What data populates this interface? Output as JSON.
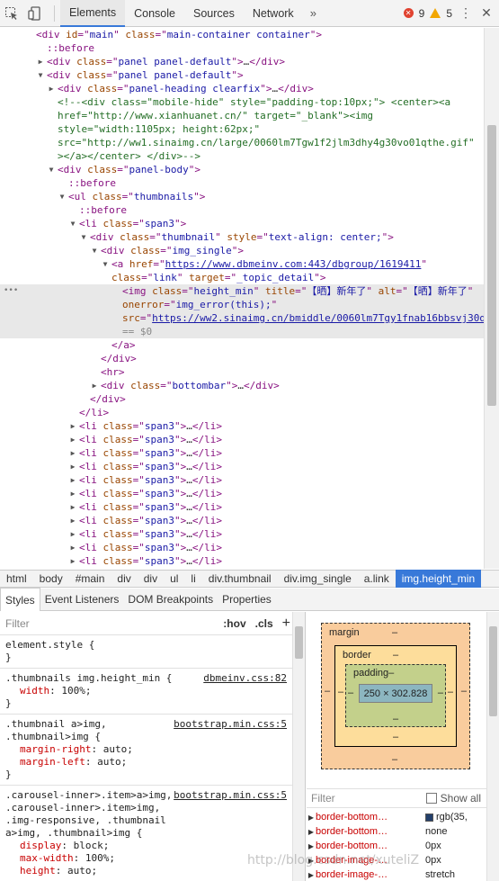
{
  "toolbar": {
    "tabs": [
      "Elements",
      "Console",
      "Sources",
      "Network"
    ],
    "more": "»",
    "error_count": "9",
    "warning_count": "5"
  },
  "dom": {
    "lines": [
      {
        "indent": 40,
        "parts": [
          [
            "tag",
            "<div "
          ],
          [
            "attr",
            "id"
          ],
          [
            "punct",
            "=\""
          ],
          [
            "val",
            "main"
          ],
          [
            "punct",
            "\" "
          ],
          [
            "attr",
            "class"
          ],
          [
            "punct",
            "=\""
          ],
          [
            "val",
            "main-container container"
          ],
          [
            "punct",
            "\">"
          ]
        ]
      },
      {
        "indent": 52,
        "parts": [
          [
            "pseudo",
            "::before"
          ]
        ]
      },
      {
        "indent": 52,
        "arrow": "▶",
        "parts": [
          [
            "tag",
            "<div "
          ],
          [
            "attr",
            "class"
          ],
          [
            "punct",
            "=\""
          ],
          [
            "val",
            "panel panel-default"
          ],
          [
            "punct",
            "\">"
          ],
          [
            "ell",
            "…"
          ],
          [
            "tag",
            "</div>"
          ]
        ]
      },
      {
        "indent": 52,
        "arrow": "▼",
        "parts": [
          [
            "tag",
            "<div "
          ],
          [
            "attr",
            "class"
          ],
          [
            "punct",
            "=\""
          ],
          [
            "val",
            "panel panel-default"
          ],
          [
            "punct",
            "\">"
          ]
        ]
      },
      {
        "indent": 64,
        "arrow": "▶",
        "parts": [
          [
            "tag",
            "<div "
          ],
          [
            "attr",
            "class"
          ],
          [
            "punct",
            "=\""
          ],
          [
            "val",
            "panel-heading clearfix"
          ],
          [
            "punct",
            "\">"
          ],
          [
            "ell",
            "…"
          ],
          [
            "tag",
            "</div>"
          ]
        ]
      },
      {
        "indent": 64,
        "wrap": true,
        "parts": [
          [
            "cmt",
            "<!--<div class=\"mobile-hide\" style=\"padding-top:10px;\"> <center><a href=\"http://www.xianhuanet.cn/\" target=\"_blank\"><img style=\"width:1105px; height:62px;\" src=\"http://ww1.sinaimg.cn/large/0060lm7Tgw1f2jlm3dhy4g30vo01qthe.gif\" ></a></center> </div>-->"
          ]
        ]
      },
      {
        "indent": 64,
        "arrow": "▼",
        "parts": [
          [
            "tag",
            "<div "
          ],
          [
            "attr",
            "class"
          ],
          [
            "punct",
            "=\""
          ],
          [
            "val",
            "panel-body"
          ],
          [
            "punct",
            "\">"
          ]
        ]
      },
      {
        "indent": 76,
        "parts": [
          [
            "pseudo",
            "::before"
          ]
        ]
      },
      {
        "indent": 76,
        "arrow": "▼",
        "parts": [
          [
            "tag",
            "<ul "
          ],
          [
            "attr",
            "class"
          ],
          [
            "punct",
            "=\""
          ],
          [
            "val",
            "thumbnails"
          ],
          [
            "punct",
            "\">"
          ]
        ]
      },
      {
        "indent": 88,
        "parts": [
          [
            "pseudo",
            "::before"
          ]
        ]
      },
      {
        "indent": 88,
        "arrow": "▼",
        "parts": [
          [
            "tag",
            "<li "
          ],
          [
            "attr",
            "class"
          ],
          [
            "punct",
            "=\""
          ],
          [
            "val",
            "span3"
          ],
          [
            "punct",
            "\">"
          ]
        ]
      },
      {
        "indent": 100,
        "arrow": "▼",
        "parts": [
          [
            "tag",
            "<div "
          ],
          [
            "attr",
            "class"
          ],
          [
            "punct",
            "=\""
          ],
          [
            "val",
            "thumbnail"
          ],
          [
            "punct",
            "\" "
          ],
          [
            "attr",
            "style"
          ],
          [
            "punct",
            "=\""
          ],
          [
            "val",
            "text-align: center;"
          ],
          [
            "punct",
            "\">"
          ]
        ]
      },
      {
        "indent": 112,
        "arrow": "▼",
        "parts": [
          [
            "tag",
            "<div "
          ],
          [
            "attr",
            "class"
          ],
          [
            "punct",
            "=\""
          ],
          [
            "val",
            "img_single"
          ],
          [
            "punct",
            "\">"
          ]
        ]
      },
      {
        "indent": 124,
        "arrow": "▼",
        "wrap": true,
        "parts": [
          [
            "tag",
            "<a "
          ],
          [
            "attr",
            "href"
          ],
          [
            "punct",
            "=\""
          ],
          [
            "link",
            "https://www.dbmeinv.com:443/dbgroup/1619411"
          ],
          [
            "punct",
            "\" "
          ],
          [
            "attr",
            "class"
          ],
          [
            "punct",
            "=\""
          ],
          [
            "val",
            "link"
          ],
          [
            "punct",
            "\" "
          ],
          [
            "attr",
            "target"
          ],
          [
            "punct",
            "=\""
          ],
          [
            "val",
            "_topic_detail"
          ],
          [
            "punct",
            "\">"
          ]
        ]
      },
      {
        "indent": 136,
        "selected": true,
        "wrap": true,
        "parts": [
          [
            "tag",
            "<img "
          ],
          [
            "attr",
            "class"
          ],
          [
            "punct",
            "=\""
          ],
          [
            "val",
            "height_min"
          ],
          [
            "punct",
            "\" "
          ],
          [
            "attr",
            "title"
          ],
          [
            "punct",
            "=\""
          ],
          [
            "val",
            "【晒】新年了"
          ],
          [
            "punct",
            "\" "
          ],
          [
            "attr",
            "alt"
          ],
          [
            "punct",
            "=\""
          ],
          [
            "val",
            "【晒】新年了"
          ],
          [
            "punct",
            "\" "
          ],
          [
            "attr",
            "onerror"
          ],
          [
            "punct",
            "=\""
          ],
          [
            "val",
            "img_error(this);"
          ],
          [
            "punct",
            "\" "
          ],
          [
            "attr",
            "src"
          ],
          [
            "punct",
            "=\""
          ],
          [
            "link",
            "https://ww2.sinaimg.cn/bmiddle/0060lm7Tgy1fnab16bbsvj30dw0gujt8.jpg"
          ],
          [
            "punct",
            "\">"
          ],
          [
            "dollar",
            " == $0"
          ]
        ]
      },
      {
        "indent": 124,
        "parts": [
          [
            "tag",
            "</a>"
          ]
        ]
      },
      {
        "indent": 112,
        "parts": [
          [
            "tag",
            "</div>"
          ]
        ]
      },
      {
        "indent": 112,
        "parts": [
          [
            "tag",
            "<hr>"
          ]
        ]
      },
      {
        "indent": 112,
        "arrow": "▶",
        "parts": [
          [
            "tag",
            "<div "
          ],
          [
            "attr",
            "class"
          ],
          [
            "punct",
            "=\""
          ],
          [
            "val",
            "bottombar"
          ],
          [
            "punct",
            "\">"
          ],
          [
            "ell",
            "…"
          ],
          [
            "tag",
            "</div>"
          ]
        ]
      },
      {
        "indent": 100,
        "parts": [
          [
            "tag",
            "</div>"
          ]
        ]
      },
      {
        "indent": 88,
        "parts": [
          [
            "tag",
            "</li>"
          ]
        ]
      },
      {
        "indent": 88,
        "arrow": "▶",
        "parts": [
          [
            "tag",
            "<li "
          ],
          [
            "attr",
            "class"
          ],
          [
            "punct",
            "=\""
          ],
          [
            "val",
            "span3"
          ],
          [
            "punct",
            "\">"
          ],
          [
            "ell",
            "…"
          ],
          [
            "tag",
            "</li>"
          ]
        ]
      },
      {
        "indent": 88,
        "arrow": "▶",
        "parts": [
          [
            "tag",
            "<li "
          ],
          [
            "attr",
            "class"
          ],
          [
            "punct",
            "=\""
          ],
          [
            "val",
            "span3"
          ],
          [
            "punct",
            "\">"
          ],
          [
            "ell",
            "…"
          ],
          [
            "tag",
            "</li>"
          ]
        ]
      },
      {
        "indent": 88,
        "arrow": "▶",
        "parts": [
          [
            "tag",
            "<li "
          ],
          [
            "attr",
            "class"
          ],
          [
            "punct",
            "=\""
          ],
          [
            "val",
            "span3"
          ],
          [
            "punct",
            "\">"
          ],
          [
            "ell",
            "…"
          ],
          [
            "tag",
            "</li>"
          ]
        ]
      },
      {
        "indent": 88,
        "arrow": "▶",
        "parts": [
          [
            "tag",
            "<li "
          ],
          [
            "attr",
            "class"
          ],
          [
            "punct",
            "=\""
          ],
          [
            "val",
            "span3"
          ],
          [
            "punct",
            "\">"
          ],
          [
            "ell",
            "…"
          ],
          [
            "tag",
            "</li>"
          ]
        ]
      },
      {
        "indent": 88,
        "arrow": "▶",
        "parts": [
          [
            "tag",
            "<li "
          ],
          [
            "attr",
            "class"
          ],
          [
            "punct",
            "=\""
          ],
          [
            "val",
            "span3"
          ],
          [
            "punct",
            "\">"
          ],
          [
            "ell",
            "…"
          ],
          [
            "tag",
            "</li>"
          ]
        ]
      },
      {
        "indent": 88,
        "arrow": "▶",
        "parts": [
          [
            "tag",
            "<li "
          ],
          [
            "attr",
            "class"
          ],
          [
            "punct",
            "=\""
          ],
          [
            "val",
            "span3"
          ],
          [
            "punct",
            "\">"
          ],
          [
            "ell",
            "…"
          ],
          [
            "tag",
            "</li>"
          ]
        ]
      },
      {
        "indent": 88,
        "arrow": "▶",
        "parts": [
          [
            "tag",
            "<li "
          ],
          [
            "attr",
            "class"
          ],
          [
            "punct",
            "=\""
          ],
          [
            "val",
            "span3"
          ],
          [
            "punct",
            "\">"
          ],
          [
            "ell",
            "…"
          ],
          [
            "tag",
            "</li>"
          ]
        ]
      },
      {
        "indent": 88,
        "arrow": "▶",
        "parts": [
          [
            "tag",
            "<li "
          ],
          [
            "attr",
            "class"
          ],
          [
            "punct",
            "=\""
          ],
          [
            "val",
            "span3"
          ],
          [
            "punct",
            "\">"
          ],
          [
            "ell",
            "…"
          ],
          [
            "tag",
            "</li>"
          ]
        ]
      },
      {
        "indent": 88,
        "arrow": "▶",
        "parts": [
          [
            "tag",
            "<li "
          ],
          [
            "attr",
            "class"
          ],
          [
            "punct",
            "=\""
          ],
          [
            "val",
            "span3"
          ],
          [
            "punct",
            "\">"
          ],
          [
            "ell",
            "…"
          ],
          [
            "tag",
            "</li>"
          ]
        ]
      },
      {
        "indent": 88,
        "arrow": "▶",
        "parts": [
          [
            "tag",
            "<li "
          ],
          [
            "attr",
            "class"
          ],
          [
            "punct",
            "=\""
          ],
          [
            "val",
            "span3"
          ],
          [
            "punct",
            "\">"
          ],
          [
            "ell",
            "…"
          ],
          [
            "tag",
            "</li>"
          ]
        ]
      },
      {
        "indent": 88,
        "arrow": "▶",
        "parts": [
          [
            "tag",
            "<li "
          ],
          [
            "attr",
            "class"
          ],
          [
            "punct",
            "=\""
          ],
          [
            "val",
            "span3"
          ],
          [
            "punct",
            "\">"
          ],
          [
            "ell",
            "…"
          ],
          [
            "tag",
            "</li>"
          ]
        ]
      },
      {
        "indent": 88,
        "arrow": "▶",
        "parts": [
          [
            "tag",
            "<li "
          ],
          [
            "attr",
            "class"
          ],
          [
            "punct",
            "=\""
          ],
          [
            "val",
            "span3"
          ],
          [
            "punct",
            "\">"
          ],
          [
            "ell",
            "…"
          ],
          [
            "tag",
            "</li>"
          ]
        ]
      },
      {
        "indent": 88,
        "arrow": "▶",
        "parts": [
          [
            "tag",
            "<li "
          ],
          [
            "attr",
            "class"
          ],
          [
            "punct",
            "=\""
          ],
          [
            "val",
            "span3"
          ],
          [
            "punct",
            "\">"
          ],
          [
            "ell",
            "…"
          ],
          [
            "tag",
            "</li>"
          ]
        ]
      }
    ]
  },
  "breadcrumbs": [
    "html",
    "body",
    "#main",
    "div",
    "div",
    "ul",
    "li",
    "div.thumbnail",
    "div.img_single",
    "a.link",
    "img.height_min"
  ],
  "subtabs": [
    "Styles",
    "Event Listeners",
    "DOM Breakpoints",
    "Properties"
  ],
  "styles": {
    "filter_placeholder": "Filter",
    "hov": ":hov",
    "cls": ".cls",
    "plus": "+",
    "rules": [
      {
        "selector": "element.style {",
        "source": "",
        "props": [],
        "close": "}"
      },
      {
        "selector": ".thumbnails img.height_min {",
        "source": "dbmeinv.css:82",
        "props": [
          [
            "width",
            "100%;"
          ]
        ],
        "close": "}"
      },
      {
        "selector": ".thumbnail a>img, .thumbnail>img {",
        "source": "bootstrap.min.css:5",
        "props": [
          [
            "margin-right",
            "auto;"
          ],
          [
            "margin-left",
            "auto;"
          ]
        ],
        "close": "}"
      },
      {
        "selector": ".carousel-inner>.item>a>img, .carousel-inner>.item>img, .img-responsive, .thumbnail a>img, .thumbnail>img {",
        "source": "bootstrap.min.css:5",
        "props": [
          [
            "display",
            "block;"
          ],
          [
            "max-width",
            "100%;"
          ],
          [
            "height",
            "auto;"
          ]
        ],
        "close": ""
      }
    ]
  },
  "boxmodel": {
    "margin_label": "margin",
    "border_label": "border",
    "padding_label": "padding–",
    "content": "250 × 302.828",
    "dash": "–"
  },
  "computed": {
    "filter_placeholder": "Filter",
    "show_all": "Show all",
    "props": [
      {
        "name": "border-bottom…",
        "value": "rgb(35,",
        "swatch": "#233f6b"
      },
      {
        "name": "border-bottom…",
        "value": "none"
      },
      {
        "name": "border-bottom…",
        "value": "0px"
      },
      {
        "name": "border-image-…",
        "value": "0px"
      },
      {
        "name": "border-image-…",
        "value": "stretch"
      }
    ]
  },
  "watermark": "http://blog.csdn.net/xuteliZ"
}
